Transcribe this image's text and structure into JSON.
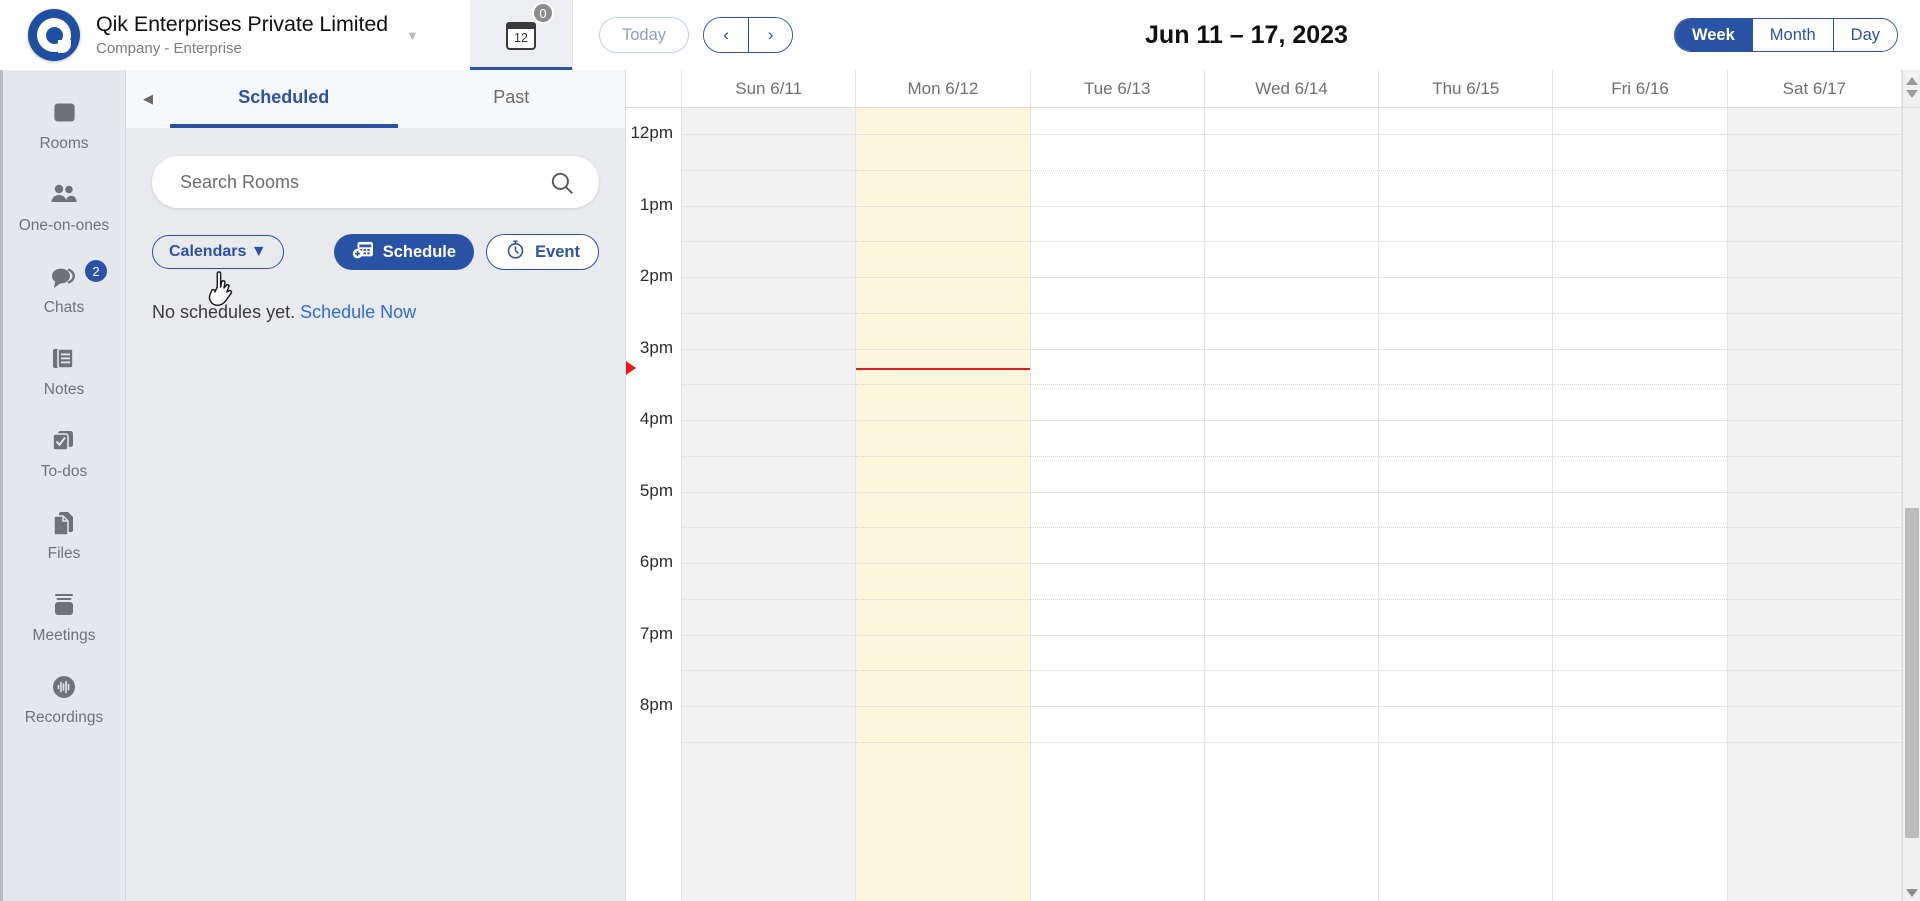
{
  "brand": {
    "title": "Qik Enterprises Private Limited",
    "subtitle": "Company - Enterprise",
    "caret": "▼",
    "logo_icon": "qik-logo-icon"
  },
  "calendar_tab": {
    "day_number": "12",
    "badge_count": "0",
    "icon": "calendar-icon"
  },
  "toolbar": {
    "today_label": "Today",
    "prev_label": "‹",
    "next_label": "›",
    "range_title": "Jun 11 – 17, 2023",
    "views": [
      {
        "label": "Week",
        "active": true
      },
      {
        "label": "Month",
        "active": false
      },
      {
        "label": "Day",
        "active": false
      }
    ]
  },
  "rail": {
    "items": [
      {
        "label": "Rooms",
        "icon": "rooms-icon",
        "badge": null
      },
      {
        "label": "One-on-ones",
        "icon": "people-icon",
        "badge": null
      },
      {
        "label": "Chats",
        "icon": "chat-bubbles-icon",
        "badge": "2"
      },
      {
        "label": "Notes",
        "icon": "notes-icon",
        "badge": null
      },
      {
        "label": "To-dos",
        "icon": "checkbox-icon",
        "badge": null
      },
      {
        "label": "Files",
        "icon": "files-icon",
        "badge": null
      },
      {
        "label": "Meetings",
        "icon": "meetings-icon",
        "badge": null
      },
      {
        "label": "Recordings",
        "icon": "recordings-icon",
        "badge": null
      }
    ]
  },
  "panel": {
    "collapse_label": "◀",
    "tabs": [
      {
        "label": "Scheduled",
        "active": true
      },
      {
        "label": "Past",
        "active": false
      }
    ],
    "search": {
      "placeholder": "Search Rooms",
      "value": "",
      "icon": "search-icon"
    },
    "calendars_button": {
      "label": "Calendars",
      "caret": "▼"
    },
    "schedule_button": {
      "label": "Schedule",
      "icon": "schedule-add-icon"
    },
    "event_button": {
      "label": "Event",
      "icon": "stopwatch-icon"
    },
    "empty_state": {
      "text": "No schedules yet.",
      "link": "Schedule Now"
    }
  },
  "grid": {
    "days": [
      {
        "label": "Sun 6/11",
        "state": "shade"
      },
      {
        "label": "Mon 6/12",
        "state": "today"
      },
      {
        "label": "Tue 6/13",
        "state": "normal"
      },
      {
        "label": "Wed 6/14",
        "state": "normal"
      },
      {
        "label": "Thu 6/15",
        "state": "normal"
      },
      {
        "label": "Fri 6/16",
        "state": "normal"
      },
      {
        "label": "Sat 6/17",
        "state": "shade"
      }
    ],
    "hours": [
      "12pm",
      "1pm",
      "2pm",
      "3pm",
      "4pm",
      "5pm",
      "6pm",
      "7pm",
      "8pm"
    ],
    "now_indicator": {
      "hour_index": 3,
      "offset_fraction": 0.27,
      "color": "#e11b1b",
      "day_index": 1
    }
  },
  "colors": {
    "accent": "#2a52a5",
    "today_bg": "#fdf6dd",
    "shade_bg": "#f2f2f2",
    "rail_bg": "#e4e7ec",
    "panel_bg": "#e8eaee",
    "now_red": "#e11b1b"
  }
}
